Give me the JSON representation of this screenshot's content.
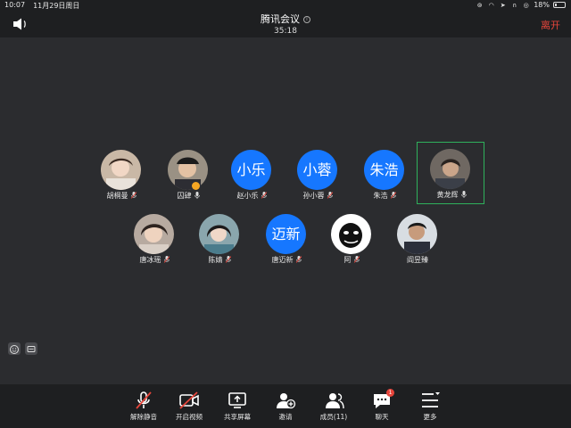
{
  "status_bar": {
    "time": "10:07",
    "date": "11月29日周日",
    "battery": "18%",
    "battery_level": 0.18
  },
  "header": {
    "title": "腾讯会议",
    "timer": "35:18",
    "leave_label": "离开"
  },
  "participants": [
    {
      "name": "胡桐曼",
      "avatar": "photo",
      "mic": "muted"
    },
    {
      "name": "囚肆",
      "avatar": "photo",
      "mic": "on",
      "badge": true
    },
    {
      "name": "赵小乐",
      "avatar_text": "小乐",
      "mic": "muted"
    },
    {
      "name": "孙小蓉",
      "avatar_text": "小蓉",
      "mic": "muted"
    },
    {
      "name": "朱浩",
      "avatar_text": "朱浩",
      "mic": "muted"
    },
    {
      "name": "黄龙辉",
      "avatar": "photo",
      "mic": "on",
      "active": true
    },
    {
      "name": "唐冰瑶",
      "avatar": "photo",
      "mic": "muted"
    },
    {
      "name": "陈婧",
      "avatar": "photo",
      "mic": "muted"
    },
    {
      "name": "唐迈新",
      "avatar_text": "迈新",
      "mic": "muted"
    },
    {
      "name": "阿",
      "avatar": "photo",
      "mic": "muted"
    },
    {
      "name": "阎昱臻",
      "avatar": "photo",
      "mic": "none"
    }
  ],
  "toolbar": [
    {
      "label": "解除静音",
      "icon": "mic-muted-icon"
    },
    {
      "label": "开启视频",
      "icon": "camera-off-icon"
    },
    {
      "label": "共享屏幕",
      "icon": "share-screen-icon"
    },
    {
      "label": "邀请",
      "icon": "invite-icon"
    },
    {
      "label": "成员(11)",
      "icon": "members-icon"
    },
    {
      "label": "聊天",
      "icon": "chat-icon",
      "badge": "1"
    },
    {
      "label": "更多",
      "icon": "more-icon"
    }
  ],
  "colors": {
    "accent_blue": "#1677ff",
    "leave_red": "#e6453b",
    "active_border": "#2fb15c",
    "background": "#2b2c2f"
  }
}
